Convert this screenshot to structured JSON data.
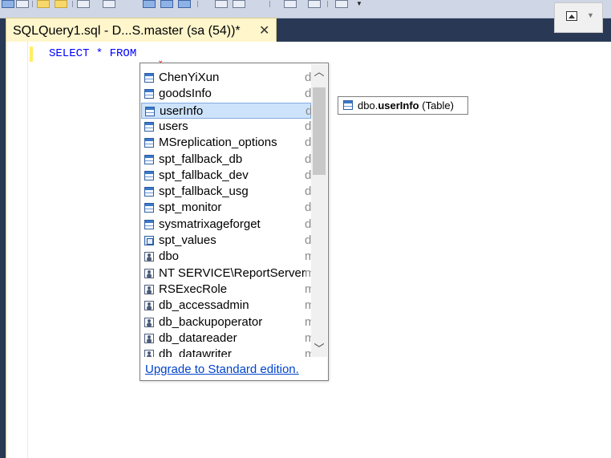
{
  "tab": {
    "title": "SQLQuery1.sql - D...S.master (sa (54))*",
    "close": "✕"
  },
  "editor": {
    "code": "SELECT * FROM"
  },
  "popup": {
    "items": [
      {
        "name": "ChenYiXun",
        "schema": "d",
        "icon": "table-icon"
      },
      {
        "name": "goodsInfo",
        "schema": "d",
        "icon": "table-icon"
      },
      {
        "name": "userInfo",
        "schema": "d",
        "icon": "table-icon",
        "selected": true
      },
      {
        "name": "users",
        "schema": "d",
        "icon": "table-icon"
      },
      {
        "name": "MSreplication_options",
        "schema": "d",
        "icon": "table-icon"
      },
      {
        "name": "spt_fallback_db",
        "schema": "d",
        "icon": "table-icon"
      },
      {
        "name": "spt_fallback_dev",
        "schema": "d",
        "icon": "table-icon"
      },
      {
        "name": "spt_fallback_usg",
        "schema": "d",
        "icon": "table-icon"
      },
      {
        "name": "spt_monitor",
        "schema": "d",
        "icon": "table-icon"
      },
      {
        "name": "sysmatrixageforget",
        "schema": "d",
        "icon": "table-icon"
      },
      {
        "name": "spt_values",
        "schema": "d",
        "icon": "view-icon"
      },
      {
        "name": "dbo",
        "schema": "m",
        "icon": "user-icon"
      },
      {
        "name": "NT SERVICE\\ReportServer",
        "schema": "m",
        "icon": "user-icon"
      },
      {
        "name": "RSExecRole",
        "schema": "m",
        "icon": "user-icon"
      },
      {
        "name": "db_accessadmin",
        "schema": "m",
        "icon": "user-icon"
      },
      {
        "name": "db_backupoperator",
        "schema": "m",
        "icon": "user-icon"
      },
      {
        "name": "db_datareader",
        "schema": "m",
        "icon": "user-icon"
      },
      {
        "name": "db_datawriter",
        "schema": "m",
        "icon": "user-icon"
      }
    ],
    "upgrade": "Upgrade to Standard edition."
  },
  "tooltip": {
    "schema": "dbo.",
    "name": "userInfo",
    "type": "(Table)"
  },
  "colors": {
    "background": "#293955",
    "tab": "#fff6cc",
    "selection": "#cde3fb",
    "keyword": "#0000ff",
    "link": "#0044cc"
  }
}
